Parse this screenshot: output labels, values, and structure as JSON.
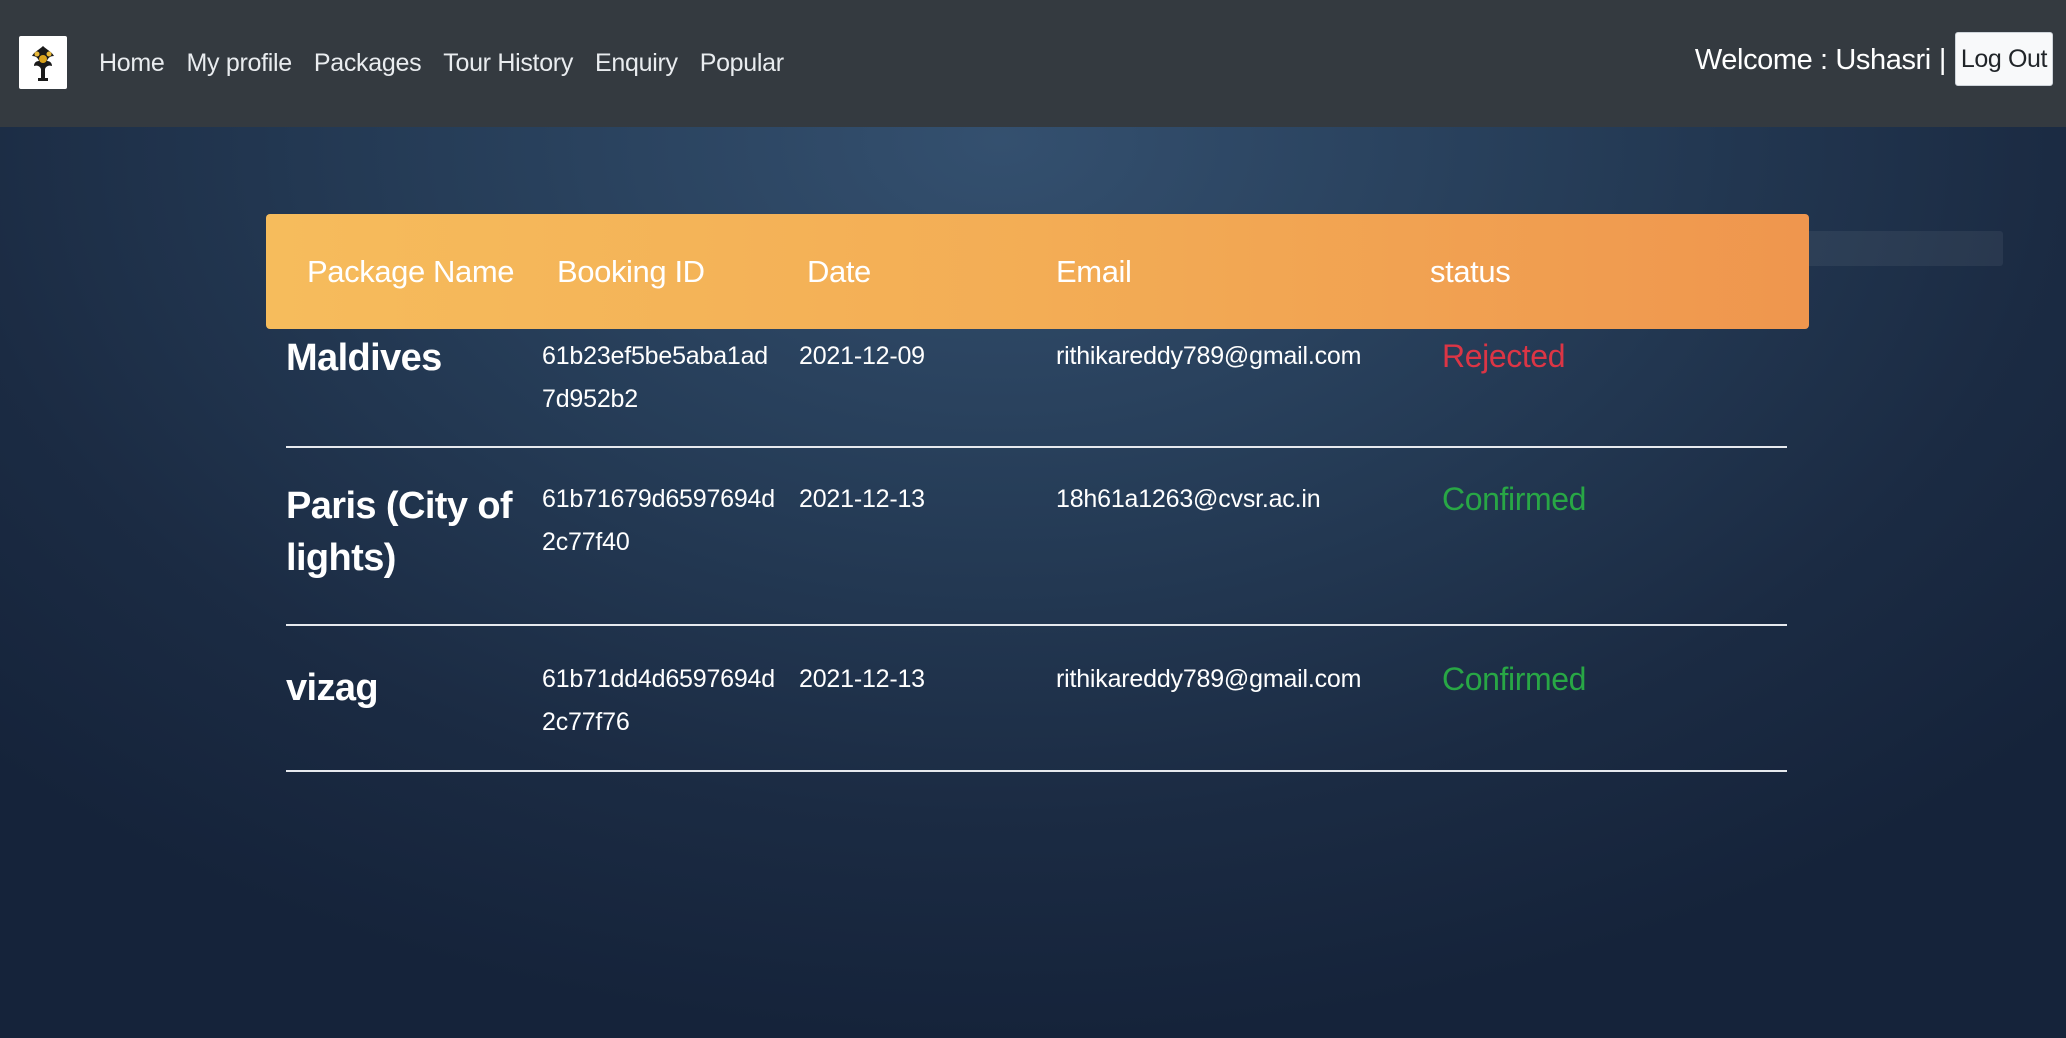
{
  "nav": {
    "links": [
      "Home",
      "My profile",
      "Packages",
      "Tour History",
      "Enquiry",
      "Popular"
    ],
    "welcome_label": "Welcome : Ushasri",
    "separator": "|",
    "logout_label": "Log Out"
  },
  "table": {
    "headers": [
      "Package Name",
      "Booking ID",
      "Date",
      "Email",
      "status"
    ],
    "rows": [
      {
        "package": "Maldives",
        "booking_id": "61b23ef5be5aba1ad7d952b2",
        "date": "2021-12-09",
        "email": "rithikareddy789@gmail.com",
        "status": "Rejected"
      },
      {
        "package": "Paris (City of lights)",
        "booking_id": "61b71679d6597694d2c77f40",
        "date": "2021-12-13",
        "email": "18h61a1263@cvsr.ac.in",
        "status": "Confirmed"
      },
      {
        "package": "vizag",
        "booking_id": "61b71dd4d6597694d2c77f76",
        "date": "2021-12-13",
        "email": "rithikareddy789@gmail.com",
        "status": "Confirmed"
      }
    ]
  },
  "colors": {
    "navbar": "#343a40",
    "header_gradient_start": "#f6bc5c",
    "header_gradient_end": "#ef964e",
    "rejected": "#dc3545",
    "confirmed": "#28a745"
  }
}
